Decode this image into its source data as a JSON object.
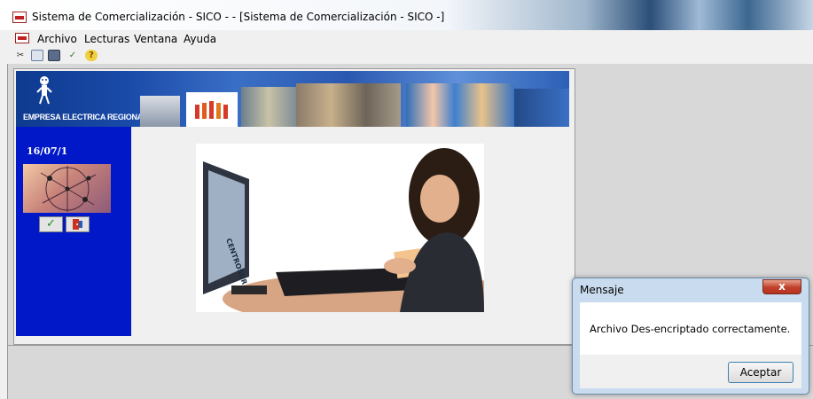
{
  "window": {
    "title": "Sistema de Comercialización - SICO - - [Sistema de Comercialización - SICO -]",
    "app_icon": "sico-app-icon"
  },
  "menu": {
    "items": [
      "Archivo",
      "Lecturas",
      "Ventana",
      "Ayuda"
    ]
  },
  "toolbar": {
    "tools": [
      "cut-icon",
      "copy-icon",
      "paste-icon",
      "check-tool-icon",
      "help-icon"
    ]
  },
  "banner": {
    "organization": "EMPRESA ELECTRICA REGIONAL",
    "logo_icon": "mascot-logo-icon"
  },
  "sidebar": {
    "date": "16/07/1",
    "accept_icon": "checkmark-icon",
    "exit_icon": "exit-door-icon"
  },
  "photo": {
    "monitor_text": "CENTROSUR"
  },
  "dialog": {
    "title": "Mensaje",
    "close_label": "x",
    "message": "Archivo Des-encriptado correctamente.",
    "button_label": "Aceptar"
  },
  "colors": {
    "sidebar_blue": "#0018c8",
    "banner_blue": "#1a4aa8",
    "close_red": "#c0402a"
  }
}
